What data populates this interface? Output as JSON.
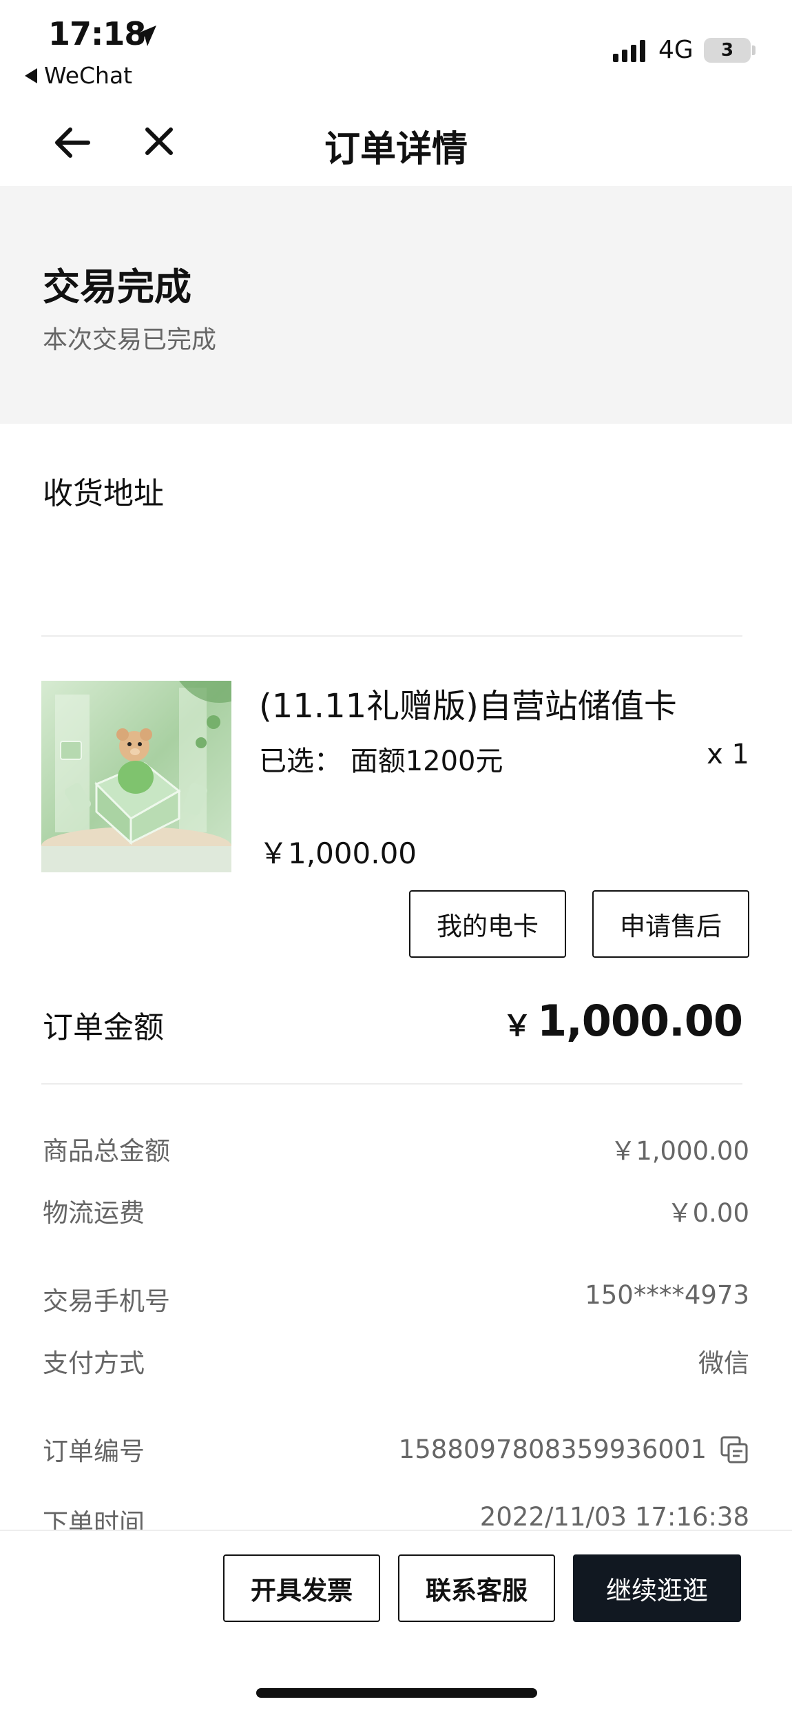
{
  "status_bar": {
    "time": "17:18",
    "back_app": "WeChat",
    "network": "4G",
    "battery": "3"
  },
  "nav": {
    "title": "订单详情"
  },
  "order_status": {
    "title": "交易完成",
    "subtitle": "本次交易已完成"
  },
  "address": {
    "title": "收货地址"
  },
  "product": {
    "name": "(11.11礼赠版)自营站储值卡",
    "spec": "已选：  面额1200元",
    "qty": "x 1",
    "price": "￥1,000.00",
    "buttons": {
      "my_card": "我的电卡",
      "after_sale": "申请售后"
    }
  },
  "order_total": {
    "label": "订单金额",
    "currency": "￥",
    "amount": "1,000.00"
  },
  "details": {
    "goods_total_label": "商品总金额",
    "goods_total_value": "￥1,000.00",
    "shipping_label": "物流运费",
    "shipping_value": "￥0.00",
    "phone_label": "交易手机号",
    "phone_value": "150****4973",
    "payment_label": "支付方式",
    "payment_value": "微信",
    "order_no_label": "订单编号",
    "order_no_value": "1588097808359936001",
    "order_time_label": "下单时间",
    "order_time_value": "2022/11/03 17:16:38"
  },
  "bottom_bar": {
    "invoice": "开具发票",
    "contact": "联系客服",
    "continue": "继续逛逛"
  },
  "colors": {
    "panel_bg": "#f4f4f4",
    "primary_dark": "#111821",
    "muted_text": "#666666"
  }
}
